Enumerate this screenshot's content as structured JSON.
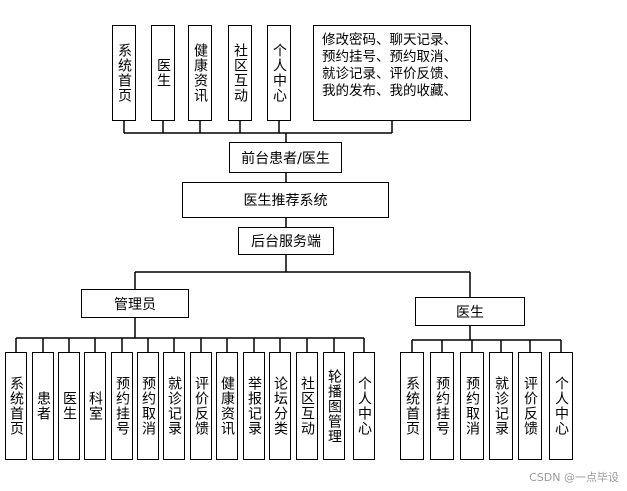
{
  "top_modules": [
    "系统首页",
    "医生",
    "健康资讯",
    "社区互动",
    "个人中心"
  ],
  "top_detail": [
    "修改密码、聊天记录、",
    "预约挂号、预约取消、",
    "就诊记录、评价反馈、",
    "我的发布、我的收藏、"
  ],
  "front_label": "前台患者/医生",
  "system_label": "医生推荐系统",
  "back_label": "后台服务端",
  "admin_label": "管理员",
  "doctor_label": "医生",
  "admin_modules": [
    "系统首页",
    "患者",
    "医生",
    "科室",
    "预约挂号",
    "预约取消",
    "就诊记录",
    "评价反馈",
    "健康资讯",
    "举报记录",
    "论坛分类",
    "社区互动",
    "轮播图管理",
    "个人中心"
  ],
  "doctor_modules": [
    "系统首页",
    "预约挂号",
    "预约取消",
    "就诊记录",
    "评价反馈",
    "个人中心"
  ],
  "watermark": "CSDN @一点毕设"
}
